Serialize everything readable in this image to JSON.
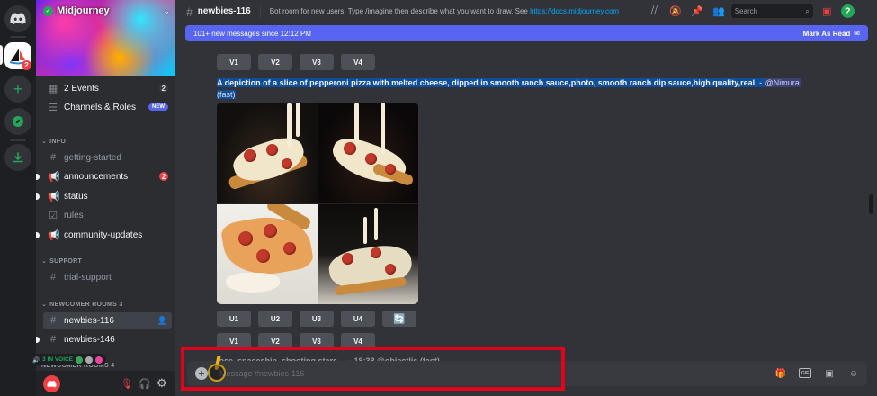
{
  "server": {
    "name": "Midjourney",
    "home_badge": "2"
  },
  "sidebar": {
    "top_items": [
      {
        "label": "2 Events",
        "count": "2"
      },
      {
        "label": "Channels & Roles",
        "badge": "NEW"
      }
    ],
    "categories": {
      "info": "INFO",
      "support": "SUPPORT",
      "newcomer": "NEWCOMER ROOMS 3",
      "newcomer2": "NEWCOMER ROOMS 4"
    },
    "info_channels": [
      {
        "label": "getting-started"
      },
      {
        "label": "announcements",
        "count": "2"
      },
      {
        "label": "status"
      },
      {
        "label": "rules"
      },
      {
        "label": "community-updates"
      }
    ],
    "support_channels": [
      {
        "label": "trial-support"
      }
    ],
    "newcomer_channels": [
      {
        "label": "newbies-116"
      },
      {
        "label": "newbies-146"
      }
    ],
    "voice_pill": "3 IN VOICE"
  },
  "topbar": {
    "channel": "newbies-116",
    "topic_text": "Bot room for new users. Type /imagine then describe what you want to draw. See ",
    "topic_link": "https://docs.midjourney.com",
    "search_placeholder": "Search"
  },
  "new_messages_bar": {
    "text": "101+ new messages since 12:12 PM",
    "action": "Mark As Read"
  },
  "messages": {
    "variation_buttons_top": [
      "V1",
      "V2",
      "V3",
      "V4"
    ],
    "prompt": "A depiction of a slice of pepperoni pizza with melted cheese, dipped in smooth ranch sauce,photo, smooth ranch dip sauce,high quality,real,",
    "mention": "@Nimura",
    "speed": "(fast)",
    "separator": "-",
    "upscale_buttons": [
      "U1",
      "U2",
      "U3",
      "U4"
    ],
    "reroll_icon": "refresh-icon",
    "variation_buttons_bottom": [
      "V1",
      "V2",
      "V3",
      "V4"
    ],
    "next_partial": "...ose, spaceship, shooting stars... -- 18:38  @objectlis (fast)"
  },
  "composer": {
    "placeholder": "Message #newbies-116"
  },
  "colors": {
    "accent": "#5865f2",
    "highlight": "#e3001b",
    "link": "#00a8fc"
  }
}
